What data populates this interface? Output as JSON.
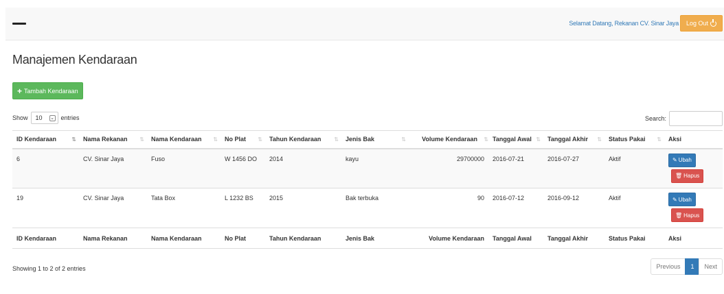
{
  "navbar": {
    "welcome_text": "Selamat Datang, Rekanan CV. Sinar Jaya",
    "logout_label": "Log Out",
    "logout_icon": "sign-out-icon"
  },
  "page": {
    "title": "Manajemen Kendaraan",
    "add_button_label": "Tambah Kendaraan",
    "add_icon": "plus-icon"
  },
  "table_controls": {
    "show_label": "Show",
    "entries_value": "10",
    "entries_label": "entries",
    "search_label": "Search:",
    "search_value": ""
  },
  "table": {
    "columns": [
      "ID Kendaraan",
      "Nama Rekanan",
      "Nama Kendaraan",
      "No Plat",
      "Tahun Kendaraan",
      "Jenis Bak",
      "Volume Kendaraan",
      "Tanggal Awal",
      "Tanggal Akhir",
      "Status Pakai",
      "Aksi"
    ],
    "rows": [
      {
        "id": "6",
        "rekanan": "CV. Sinar Jaya",
        "kendaraan": "Fuso",
        "plat": "W 1456 DO",
        "tahun": "2014",
        "bak": "kayu",
        "volume": "29700000",
        "awal": "2016-07-21",
        "akhir": "2016-07-27",
        "status": "Aktif",
        "edit_label": "Ubah",
        "delete_label": "Hapus"
      },
      {
        "id": "19",
        "rekanan": "CV. Sinar Jaya",
        "kendaraan": "Tata Box",
        "plat": "L 1232 BS",
        "tahun": "2015",
        "bak": "Bak terbuka",
        "volume": "90",
        "awal": "2016-07-12",
        "akhir": "2016-09-12",
        "status": "Aktif",
        "edit_label": "Ubah",
        "delete_label": "Hapus"
      }
    ]
  },
  "footer": {
    "info": "Showing 1 to 2 of 2 entries",
    "pagination": {
      "previous": "Previous",
      "current": "1",
      "next": "Next"
    }
  },
  "colors": {
    "success": "#5cb85c",
    "warning": "#f0ad4e",
    "primary": "#337ab7",
    "danger": "#d9534f"
  }
}
